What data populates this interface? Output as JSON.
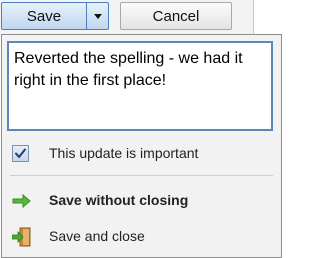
{
  "toolbar": {
    "save_label": "Save",
    "cancel_label": "Cancel"
  },
  "popup": {
    "note_text": "Reverted the spelling - we had it right in the first place!",
    "important_checked": true,
    "important_label": "This update is important",
    "save_without_closing_label": "Save without closing",
    "save_and_close_label": "Save and close",
    "icons": {
      "save_without_closing": "green-arrow-right-icon",
      "save_and_close": "exit-door-icon"
    }
  }
}
